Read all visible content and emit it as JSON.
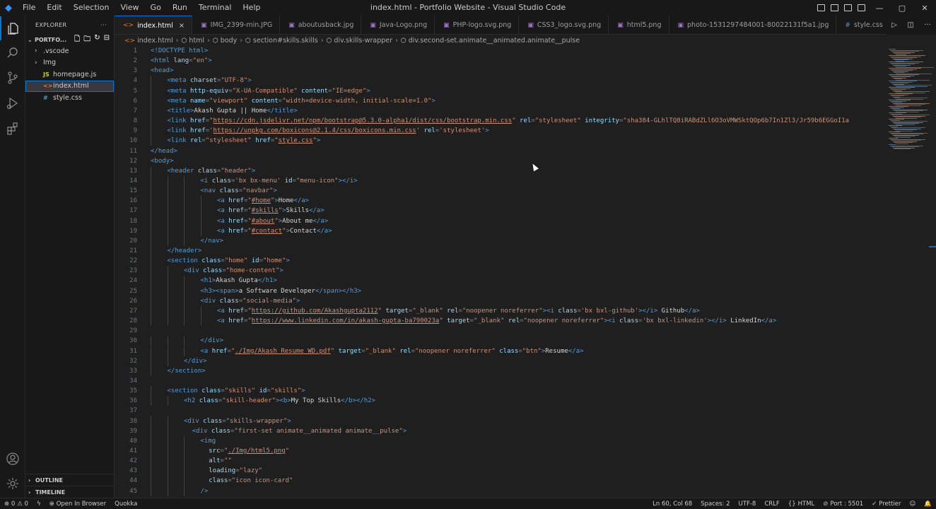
{
  "window": {
    "title": "index.html - Portfolio Website - Visual Studio Code",
    "menu": [
      "File",
      "Edit",
      "Selection",
      "View",
      "Go",
      "Run",
      "Terminal",
      "Help"
    ],
    "logo_glyph": "◆"
  },
  "activity": [
    "explorer-icon",
    "search-icon",
    "source-control-icon",
    "run-debug-icon",
    "extensions-icon",
    "account-icon",
    "gear-icon"
  ],
  "sidebar": {
    "title": "EXPLORER",
    "more": "···",
    "folder": "PORTFO...",
    "items": [
      {
        "label": ".vscode",
        "type": "folder",
        "icon": ""
      },
      {
        "label": "Img",
        "type": "folder",
        "icon": ""
      },
      {
        "label": "homepage.js",
        "type": "file",
        "icon": "JS"
      },
      {
        "label": "index.html",
        "type": "file",
        "icon": "<>",
        "selected": true
      },
      {
        "label": "style.css",
        "type": "file",
        "icon": "#"
      }
    ],
    "outline": "OUTLINE",
    "timeline": "TIMELINE"
  },
  "tabs": [
    {
      "label": "index.html",
      "icon": "<>",
      "active": true,
      "close": "×"
    },
    {
      "label": "IMG_2399-min.JPG",
      "icon": "▣"
    },
    {
      "label": "aboutusback.jpg",
      "icon": "▣"
    },
    {
      "label": "Java-Logo.png",
      "icon": "▣"
    },
    {
      "label": "PHP-logo.svg.png",
      "icon": "▣"
    },
    {
      "label": "CSS3_logo.svg.png",
      "icon": "▣"
    },
    {
      "label": "html5.png",
      "icon": "▣"
    },
    {
      "label": "photo-1531297484001-80022131f5a1.jpg",
      "icon": "▣"
    },
    {
      "label": "style.css",
      "icon": "#"
    }
  ],
  "breadcrumb": [
    "index.html",
    "html",
    "body",
    "section#skills.skills",
    "div.skills-wrapper",
    "div.second-set.animate__animated.animate__pulse"
  ],
  "code_lines": [
    {
      "n": "1",
      "ind": 0,
      "t": [
        [
          "tag",
          "<!DOCTYPE html>"
        ]
      ]
    },
    {
      "n": "2",
      "ind": 0,
      "t": [
        [
          "tag",
          "<html "
        ],
        [
          "attr",
          "lang"
        ],
        [
          "pun",
          "="
        ],
        [
          "val",
          "\"en\""
        ],
        [
          "tag",
          ">"
        ]
      ]
    },
    {
      "n": "3",
      "ind": 0,
      "t": [
        [
          "tag",
          "<head>"
        ]
      ]
    },
    {
      "n": "4",
      "ind": 1,
      "t": [
        [
          "tag",
          "<meta "
        ],
        [
          "attr",
          "charset"
        ],
        [
          "pun",
          "="
        ],
        [
          "val",
          "\"UTF-8\""
        ],
        [
          "tag",
          ">"
        ]
      ]
    },
    {
      "n": "5",
      "ind": 1,
      "t": [
        [
          "tag",
          "<meta "
        ],
        [
          "attr",
          "http-equiv"
        ],
        [
          "pun",
          "="
        ],
        [
          "val",
          "\"X-UA-Compatible\" "
        ],
        [
          "attr",
          "content"
        ],
        [
          "pun",
          "="
        ],
        [
          "val",
          "\"IE=edge\""
        ],
        [
          "tag",
          ">"
        ]
      ]
    },
    {
      "n": "6",
      "ind": 1,
      "t": [
        [
          "tag",
          "<meta "
        ],
        [
          "attr",
          "name"
        ],
        [
          "pun",
          "="
        ],
        [
          "val",
          "\"viewport\" "
        ],
        [
          "attr",
          "content"
        ],
        [
          "pun",
          "="
        ],
        [
          "val",
          "\"width=device-width, initial-scale=1.0\""
        ],
        [
          "tag",
          ">"
        ]
      ]
    },
    {
      "n": "7",
      "ind": 1,
      "t": [
        [
          "tag",
          "<title>"
        ],
        [
          "txt",
          "Akash Gupta || Home"
        ],
        [
          "tag",
          "</title>"
        ]
      ]
    },
    {
      "n": "8",
      "ind": 1,
      "t": [
        [
          "tag",
          "<link "
        ],
        [
          "attr",
          "href"
        ],
        [
          "pun",
          "="
        ],
        [
          "val",
          "\""
        ],
        [
          "link",
          "https://cdn.jsdelivr.net/npm/bootstrap@5.3.0-alpha1/dist/css/bootstrap.min.css"
        ],
        [
          "val",
          "\" "
        ],
        [
          "attr",
          "rel"
        ],
        [
          "pun",
          "="
        ],
        [
          "val",
          "\"stylesheet\" "
        ],
        [
          "attr",
          "integrity"
        ],
        [
          "pun",
          "="
        ],
        [
          "val",
          "\"sha384-GLhlTQ8iRABdZLl6O3oVMWSktQOp6b7In1Zl3/Jr59b6EGGoI1a"
        ]
      ]
    },
    {
      "n": "9",
      "ind": 1,
      "t": [
        [
          "tag",
          "<link "
        ],
        [
          "attr",
          "href"
        ],
        [
          "pun",
          "="
        ],
        [
          "val",
          "'"
        ],
        [
          "link",
          "https://unpkg.com/boxicons@2.1.4/css/boxicons.min.css"
        ],
        [
          "val",
          "' "
        ],
        [
          "attr",
          "rel"
        ],
        [
          "pun",
          "="
        ],
        [
          "val",
          "'stylesheet'"
        ],
        [
          "tag",
          ">"
        ]
      ]
    },
    {
      "n": "10",
      "ind": 1,
      "t": [
        [
          "tag",
          "<link "
        ],
        [
          "attr",
          "rel"
        ],
        [
          "pun",
          "="
        ],
        [
          "val",
          "\"stylesheet\" "
        ],
        [
          "attr",
          "href"
        ],
        [
          "pun",
          "="
        ],
        [
          "val",
          "\""
        ],
        [
          "link",
          "style.css"
        ],
        [
          "val",
          "\""
        ],
        [
          "tag",
          ">"
        ]
      ]
    },
    {
      "n": "11",
      "ind": 0,
      "t": [
        [
          "tag",
          "</head>"
        ]
      ]
    },
    {
      "n": "12",
      "ind": 0,
      "t": [
        [
          "tag",
          "<body>"
        ]
      ]
    },
    {
      "n": "13",
      "ind": 1,
      "t": [
        [
          "tag",
          "<header "
        ],
        [
          "attr",
          "class"
        ],
        [
          "pun",
          "="
        ],
        [
          "val",
          "\"header\""
        ],
        [
          "tag",
          ">"
        ]
      ]
    },
    {
      "n": "14",
      "ind": 3,
      "t": [
        [
          "tag",
          "<i "
        ],
        [
          "attr",
          "class"
        ],
        [
          "pun",
          "="
        ],
        [
          "val",
          "'bx bx-menu' "
        ],
        [
          "attr",
          "id"
        ],
        [
          "pun",
          "="
        ],
        [
          "val",
          "\"menu-icon\""
        ],
        [
          "tag",
          "></i>"
        ]
      ]
    },
    {
      "n": "15",
      "ind": 3,
      "t": [
        [
          "tag",
          "<nav "
        ],
        [
          "attr",
          "class"
        ],
        [
          "pun",
          "="
        ],
        [
          "val",
          "\"navbar\""
        ],
        [
          "tag",
          ">"
        ]
      ]
    },
    {
      "n": "16",
      "ind": 4,
      "t": [
        [
          "tag",
          "<a "
        ],
        [
          "attr",
          "href"
        ],
        [
          "pun",
          "="
        ],
        [
          "val",
          "\""
        ],
        [
          "link",
          "#home"
        ],
        [
          "val",
          "\""
        ],
        [
          "tag",
          ">"
        ],
        [
          "txt",
          "Home"
        ],
        [
          "tag",
          "</a>"
        ]
      ]
    },
    {
      "n": "17",
      "ind": 4,
      "t": [
        [
          "tag",
          "<a "
        ],
        [
          "attr",
          "href"
        ],
        [
          "pun",
          "="
        ],
        [
          "val",
          "\""
        ],
        [
          "link",
          "#skills"
        ],
        [
          "val",
          "\""
        ],
        [
          "tag",
          ">"
        ],
        [
          "txt",
          "Skills"
        ],
        [
          "tag",
          "</a>"
        ]
      ]
    },
    {
      "n": "18",
      "ind": 4,
      "t": [
        [
          "tag",
          "<a "
        ],
        [
          "attr",
          "href"
        ],
        [
          "pun",
          "="
        ],
        [
          "val",
          "\""
        ],
        [
          "link",
          "#about"
        ],
        [
          "val",
          "\""
        ],
        [
          "tag",
          ">"
        ],
        [
          "txt",
          "About me"
        ],
        [
          "tag",
          "</a>"
        ]
      ]
    },
    {
      "n": "19",
      "ind": 4,
      "t": [
        [
          "tag",
          "<a "
        ],
        [
          "attr",
          "href"
        ],
        [
          "pun",
          "="
        ],
        [
          "val",
          "\""
        ],
        [
          "link",
          "#contact"
        ],
        [
          "val",
          "\""
        ],
        [
          "tag",
          ">"
        ],
        [
          "txt",
          "Contact"
        ],
        [
          "tag",
          "</a>"
        ]
      ]
    },
    {
      "n": "20",
      "ind": 3,
      "t": [
        [
          "tag",
          "</nav>"
        ]
      ]
    },
    {
      "n": "21",
      "ind": 1,
      "t": [
        [
          "tag",
          "</header>"
        ]
      ]
    },
    {
      "n": "22",
      "ind": 1,
      "t": [
        [
          "tag",
          "<section "
        ],
        [
          "attr",
          "class"
        ],
        [
          "pun",
          "="
        ],
        [
          "val",
          "\"home\" "
        ],
        [
          "attr",
          "id"
        ],
        [
          "pun",
          "="
        ],
        [
          "val",
          "\"home\""
        ],
        [
          "tag",
          ">"
        ]
      ]
    },
    {
      "n": "23",
      "ind": 2,
      "t": [
        [
          "tag",
          "<div "
        ],
        [
          "attr",
          "class"
        ],
        [
          "pun",
          "="
        ],
        [
          "val",
          "\"home-content\""
        ],
        [
          "tag",
          ">"
        ]
      ]
    },
    {
      "n": "24",
      "ind": 3,
      "t": [
        [
          "tag",
          "<h1>"
        ],
        [
          "txt",
          "Akash Gupta"
        ],
        [
          "tag",
          "</h1>"
        ]
      ]
    },
    {
      "n": "25",
      "ind": 3,
      "t": [
        [
          "tag",
          "<h3><span>"
        ],
        [
          "txt",
          "a Software Developer"
        ],
        [
          "tag",
          "</span></h3>"
        ]
      ]
    },
    {
      "n": "26",
      "ind": 3,
      "t": [
        [
          "tag",
          "<div "
        ],
        [
          "attr",
          "class"
        ],
        [
          "pun",
          "="
        ],
        [
          "val",
          "\"social-media\""
        ],
        [
          "tag",
          ">"
        ]
      ]
    },
    {
      "n": "27",
      "ind": 4,
      "t": [
        [
          "tag",
          "<a "
        ],
        [
          "attr",
          "href"
        ],
        [
          "pun",
          "="
        ],
        [
          "val",
          "\""
        ],
        [
          "link",
          "https://github.com/Akashgupta2112"
        ],
        [
          "val",
          "\" "
        ],
        [
          "attr",
          "target"
        ],
        [
          "pun",
          "="
        ],
        [
          "val",
          "\"_blank\" "
        ],
        [
          "attr",
          "rel"
        ],
        [
          "pun",
          "="
        ],
        [
          "val",
          "\"noopener noreferrer\""
        ],
        [
          "tag",
          "><i "
        ],
        [
          "attr",
          "class"
        ],
        [
          "pun",
          "="
        ],
        [
          "val",
          "'bx bxl-github'"
        ],
        [
          "tag",
          "></i> "
        ],
        [
          "txt",
          "Github"
        ],
        [
          "tag",
          "</a>"
        ]
      ]
    },
    {
      "n": "28",
      "ind": 4,
      "t": [
        [
          "tag",
          "<a "
        ],
        [
          "attr",
          "href"
        ],
        [
          "pun",
          "="
        ],
        [
          "val",
          "\""
        ],
        [
          "link",
          "https://www.linkedin.com/in/akash-gupta-ba790023a"
        ],
        [
          "val",
          "\" "
        ],
        [
          "attr",
          "target"
        ],
        [
          "pun",
          "="
        ],
        [
          "val",
          "\"_blank\" "
        ],
        [
          "attr",
          "rel"
        ],
        [
          "pun",
          "="
        ],
        [
          "val",
          "\"noopener noreferrer\""
        ],
        [
          "tag",
          "><i "
        ],
        [
          "attr",
          "class"
        ],
        [
          "pun",
          "="
        ],
        [
          "val",
          "'bx bxl-linkedin'"
        ],
        [
          "tag",
          "></i> "
        ],
        [
          "txt",
          "LinkedIn"
        ],
        [
          "tag",
          "</a>"
        ]
      ]
    },
    {
      "n": "29",
      "ind": 0,
      "t": []
    },
    {
      "n": "30",
      "ind": 3,
      "t": [
        [
          "tag",
          "</div>"
        ]
      ]
    },
    {
      "n": "31",
      "ind": 3,
      "t": [
        [
          "tag",
          "<a "
        ],
        [
          "attr",
          "href"
        ],
        [
          "pun",
          "="
        ],
        [
          "val",
          "\""
        ],
        [
          "link",
          "./Img/Akash Resume WD.pdf"
        ],
        [
          "val",
          "\" "
        ],
        [
          "attr",
          "target"
        ],
        [
          "pun",
          "="
        ],
        [
          "val",
          "\"_blank\" "
        ],
        [
          "attr",
          "rel"
        ],
        [
          "pun",
          "="
        ],
        [
          "val",
          "\"noopener noreferrer\" "
        ],
        [
          "attr",
          "class"
        ],
        [
          "pun",
          "="
        ],
        [
          "val",
          "\"btn\""
        ],
        [
          "tag",
          ">"
        ],
        [
          "txt",
          "Resume"
        ],
        [
          "tag",
          "</a>"
        ]
      ]
    },
    {
      "n": "32",
      "ind": 2,
      "t": [
        [
          "tag",
          "</div>"
        ]
      ]
    },
    {
      "n": "33",
      "ind": 1,
      "t": [
        [
          "tag",
          "</section>"
        ]
      ]
    },
    {
      "n": "34",
      "ind": 0,
      "t": []
    },
    {
      "n": "35",
      "ind": 1,
      "t": [
        [
          "tag",
          "<section "
        ],
        [
          "attr",
          "class"
        ],
        [
          "pun",
          "="
        ],
        [
          "val",
          "\"skills\" "
        ],
        [
          "attr",
          "id"
        ],
        [
          "pun",
          "="
        ],
        [
          "val",
          "\"skills\""
        ],
        [
          "tag",
          ">"
        ]
      ]
    },
    {
      "n": "36",
      "ind": 2,
      "t": [
        [
          "tag",
          "<h2 "
        ],
        [
          "attr",
          "class"
        ],
        [
          "pun",
          "="
        ],
        [
          "val",
          "\"skill-header\""
        ],
        [
          "tag",
          "><b>"
        ],
        [
          "txt",
          "My Top Skills"
        ],
        [
          "tag",
          "</b></h2>"
        ]
      ]
    },
    {
      "n": "37",
      "ind": 0,
      "t": []
    },
    {
      "n": "38",
      "ind": 2,
      "t": [
        [
          "tag",
          "<div "
        ],
        [
          "attr",
          "class"
        ],
        [
          "pun",
          "="
        ],
        [
          "val",
          "\"skills-wrapper\""
        ],
        [
          "tag",
          ">"
        ]
      ]
    },
    {
      "n": "39",
      "ind": 2.5,
      "t": [
        [
          "tag",
          "<div "
        ],
        [
          "attr",
          "class"
        ],
        [
          "pun",
          "="
        ],
        [
          "val",
          "\"first-set animate__animated animate__pulse\""
        ],
        [
          "tag",
          ">"
        ]
      ]
    },
    {
      "n": "40",
      "ind": 3,
      "t": [
        [
          "tag",
          "<img"
        ]
      ]
    },
    {
      "n": "41",
      "ind": 3.5,
      "t": [
        [
          "attr",
          "src"
        ],
        [
          "pun",
          "="
        ],
        [
          "val",
          "\""
        ],
        [
          "link",
          "./Img/html5.png"
        ],
        [
          "val",
          "\""
        ]
      ]
    },
    {
      "n": "42",
      "ind": 3.5,
      "t": [
        [
          "attr",
          "alt"
        ],
        [
          "pun",
          "="
        ],
        [
          "val",
          "\"\""
        ]
      ]
    },
    {
      "n": "43",
      "ind": 3.5,
      "t": [
        [
          "attr",
          "loading"
        ],
        [
          "pun",
          "="
        ],
        [
          "val",
          "\"lazy\""
        ]
      ]
    },
    {
      "n": "44",
      "ind": 3.5,
      "t": [
        [
          "attr",
          "class"
        ],
        [
          "pun",
          "="
        ],
        [
          "val",
          "\"icon icon-card\""
        ]
      ]
    },
    {
      "n": "45",
      "ind": 3,
      "t": [
        [
          "tag",
          "/>"
        ]
      ]
    }
  ],
  "status": {
    "errors": "⊗ 0",
    "warnings": "⚠ 0",
    "open_in_browser": "Open In Browser",
    "quokka": "Quokka",
    "position": "Ln 60, Col 68",
    "spaces": "Spaces: 2",
    "encoding": "UTF-8",
    "eol": "CRLF",
    "language": "HTML",
    "port": "Port : 5501",
    "prettier": "Prettier"
  },
  "colors": {
    "accent": "#0078d4",
    "tag": "#569cd6",
    "attr": "#9cdcfe",
    "value": "#ce9178"
  }
}
